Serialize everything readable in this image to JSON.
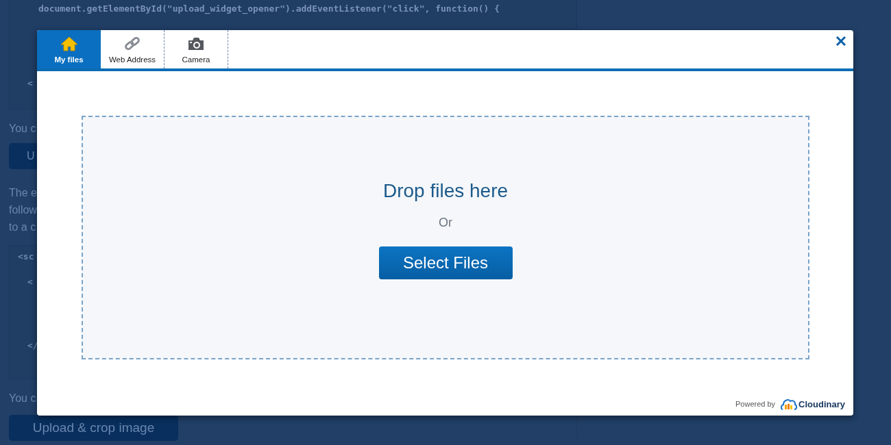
{
  "background_page": {
    "code_block_1": {
      "lines": [
        "document.getElementById(\"upload_widget_opener\").addEventListener(\"click\", function() {",
        "<"
      ]
    },
    "text_1": "You c",
    "button_1": "U",
    "paragraph_lines": [
      "The e",
      "follow",
      "to a c"
    ],
    "code_block_2": {
      "lines": [
        "<sc",
        "<",
        "</"
      ]
    },
    "text_2": "You c",
    "button_2": "Upload & crop image"
  },
  "dialog": {
    "tabs": [
      {
        "label": "My files",
        "kind": "home",
        "selected": true
      },
      {
        "label": "Web Address",
        "kind": "link",
        "selected": false
      },
      {
        "label": "Camera",
        "kind": "camera",
        "selected": false
      }
    ],
    "drop_zone": {
      "title": "Drop files here",
      "separator": "Or",
      "button": "Select Files"
    },
    "footer": {
      "powered_by": "Powered by",
      "brand": "Cloudinary"
    }
  }
}
